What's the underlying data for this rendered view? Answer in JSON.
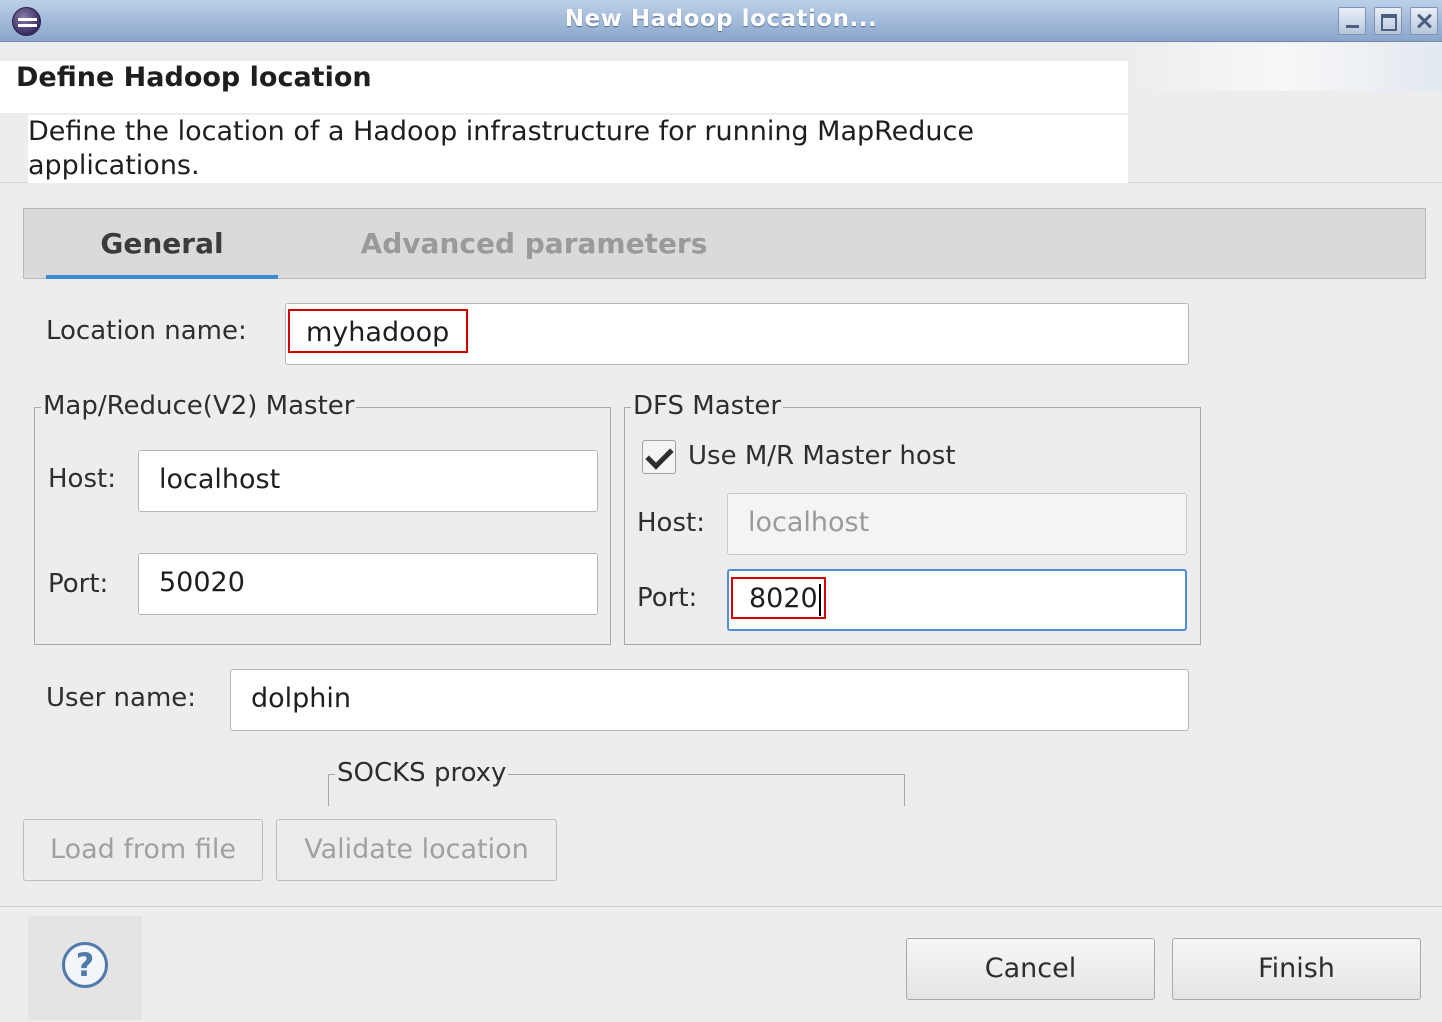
{
  "window": {
    "title": "New Hadoop location..."
  },
  "banner": {
    "title": "Define Hadoop location",
    "description": "Define the location of a Hadoop infrastructure for running MapReduce applications."
  },
  "tabs": [
    {
      "label": "General",
      "active": true
    },
    {
      "label": "Advanced parameters",
      "active": false
    }
  ],
  "general": {
    "location_name": {
      "label": "Location name:",
      "value": "myhadoop"
    },
    "mr_master": {
      "legend": "Map/Reduce(V2) Master",
      "host_label": "Host:",
      "host_value": "localhost",
      "port_label": "Port:",
      "port_value": "50020"
    },
    "dfs_master": {
      "legend": "DFS Master",
      "use_mr_host_label": "Use M/R Master host",
      "use_mr_host_checked": true,
      "host_label": "Host:",
      "host_value": "localhost",
      "port_label": "Port:",
      "port_value": "8020"
    },
    "user_name": {
      "label": "User name:",
      "value": "dolphin"
    },
    "socks_proxy": {
      "legend": "SOCKS proxy"
    }
  },
  "buttons": {
    "load_from_file": "Load from file",
    "validate_location": "Validate location",
    "cancel": "Cancel",
    "finish": "Finish",
    "help": "?"
  },
  "colors": {
    "title_bar": "#9db5d8",
    "focus_border": "#4e8fd6",
    "highlight": "#d40000",
    "tab_indicator": "#3c8bd4"
  }
}
